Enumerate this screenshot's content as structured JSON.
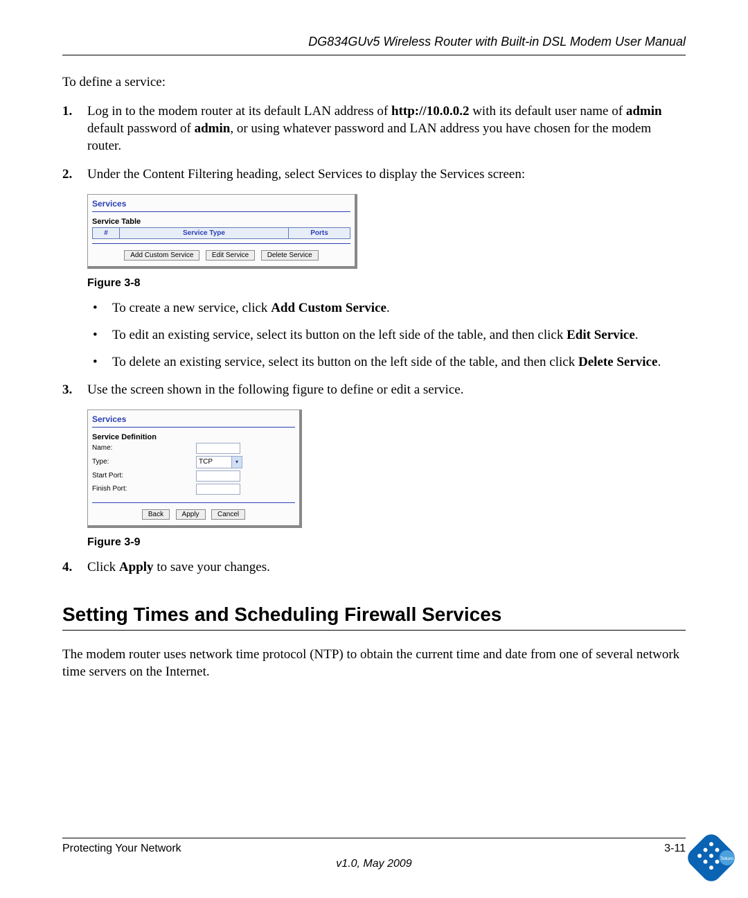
{
  "header": {
    "title": "DG834GUv5 Wireless Router with Built-in DSL Modem User Manual"
  },
  "intro": "To define a service:",
  "steps": {
    "s1_pre": "Log in to the modem router at its default LAN address of ",
    "s1_addr": "http://10.0.0.2",
    "s1_mid1": " with its default user name of ",
    "s1_admin1": "admin",
    "s1_mid2": " default password of ",
    "s1_admin2": "admin",
    "s1_post": ", or using whatever password and LAN address you have chosen for the modem router.",
    "s2": "Under the Content Filtering heading, select Services to display the Services screen:",
    "s3": "Use the screen shown in the following figure to define or edit a service.",
    "s4_pre": "Click ",
    "s4_b": "Apply",
    "s4_post": " to save your changes."
  },
  "fig1": {
    "title": "Services",
    "subtitle": "Service Table",
    "col_num": "#",
    "col_type": "Service Type",
    "col_ports": "Ports",
    "btn_add": "Add Custom Service",
    "btn_edit": "Edit Service",
    "btn_del": "Delete Service",
    "caption": "Figure 3-8"
  },
  "bullets": {
    "b1_pre": "To create a new service, click ",
    "b1_b": "Add Custom Service",
    "b1_post": ".",
    "b2_pre": "To edit an existing service, select its button on the left side of the table, and then click ",
    "b2_b": "Edit Service",
    "b2_post": ".",
    "b3_pre": "To delete an existing service, select its button on the left side of the table, and then click ",
    "b3_b": "Delete Service",
    "b3_post": "."
  },
  "fig2": {
    "title": "Services",
    "subtitle": "Service Definition",
    "lbl_name": "Name:",
    "lbl_type": "Type:",
    "type_val": "TCP",
    "lbl_start": "Start Port:",
    "lbl_finish": "Finish Port:",
    "btn_back": "Back",
    "btn_apply": "Apply",
    "btn_cancel": "Cancel",
    "caption": "Figure 3-9"
  },
  "section": {
    "heading": "Setting Times and Scheduling Firewall Services",
    "para": "The modem router uses network time protocol (NTP) to obtain the current time and date from one of several network time servers on the Internet."
  },
  "footer": {
    "left": "Protecting Your Network",
    "right": "3-11",
    "version": "v1.0, May 2009"
  },
  "logo": {
    "brand": "Telkom"
  }
}
